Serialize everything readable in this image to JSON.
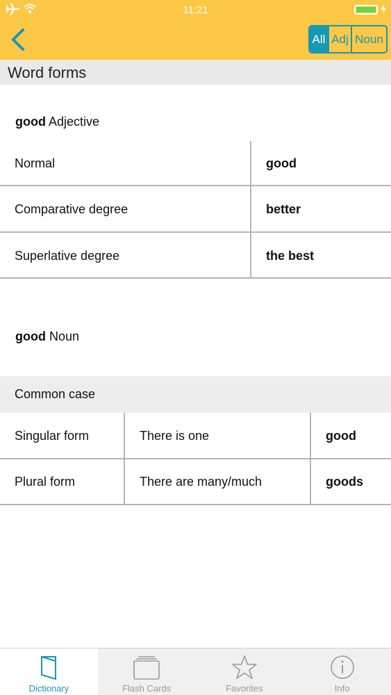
{
  "status_bar": {
    "time": "11:21"
  },
  "header": {
    "filter_options": [
      "All",
      "Adj",
      "Noun"
    ],
    "selected_filter": "All",
    "accent_color": "#1798B4",
    "background_color": "#FCC845"
  },
  "page": {
    "title": "Word forms"
  },
  "adjective": {
    "word": "good",
    "part_of_speech": "Adjective",
    "rows": [
      {
        "label": "Normal",
        "value": "good"
      },
      {
        "label": "Comparative degree",
        "value": "better"
      },
      {
        "label": "Superlative degree",
        "value": "the best"
      }
    ]
  },
  "noun": {
    "word": "good",
    "part_of_speech": "Noun",
    "section": "Common case",
    "rows": [
      {
        "label": "Singular form",
        "description": "There is one",
        "value": "good"
      },
      {
        "label": "Plural form",
        "description": "There are many/much",
        "value": "goods"
      }
    ]
  },
  "tabbar": {
    "tabs": [
      {
        "label": "Dictionary",
        "icon": "book-icon",
        "active": true
      },
      {
        "label": "Flash Cards",
        "icon": "cards-icon",
        "active": false
      },
      {
        "label": "Favorites",
        "icon": "star-icon",
        "active": false
      },
      {
        "label": "Info",
        "icon": "info-icon",
        "active": false
      }
    ]
  }
}
